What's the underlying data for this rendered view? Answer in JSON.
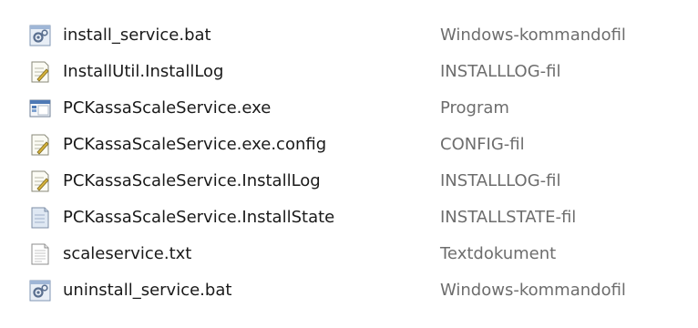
{
  "files": [
    {
      "name": "install_service.bat",
      "type": "Windows-kommandofil",
      "icon": "batch-file-icon"
    },
    {
      "name": "InstallUtil.InstallLog",
      "type": "INSTALLLOG-fil",
      "icon": "text-file-pencil-icon"
    },
    {
      "name": "PCKassaScaleService.exe",
      "type": "Program",
      "icon": "application-window-icon"
    },
    {
      "name": "PCKassaScaleService.exe.config",
      "type": "CONFIG-fil",
      "icon": "text-file-pencil-icon"
    },
    {
      "name": "PCKassaScaleService.InstallLog",
      "type": "INSTALLLOG-fil",
      "icon": "text-file-pencil-icon"
    },
    {
      "name": "PCKassaScaleService.InstallState",
      "type": "INSTALLSTATE-fil",
      "icon": "generic-file-icon"
    },
    {
      "name": "scaleservice.txt",
      "type": "Textdokument",
      "icon": "text-document-icon"
    },
    {
      "name": "uninstall_service.bat",
      "type": "Windows-kommandofil",
      "icon": "batch-file-icon"
    }
  ]
}
